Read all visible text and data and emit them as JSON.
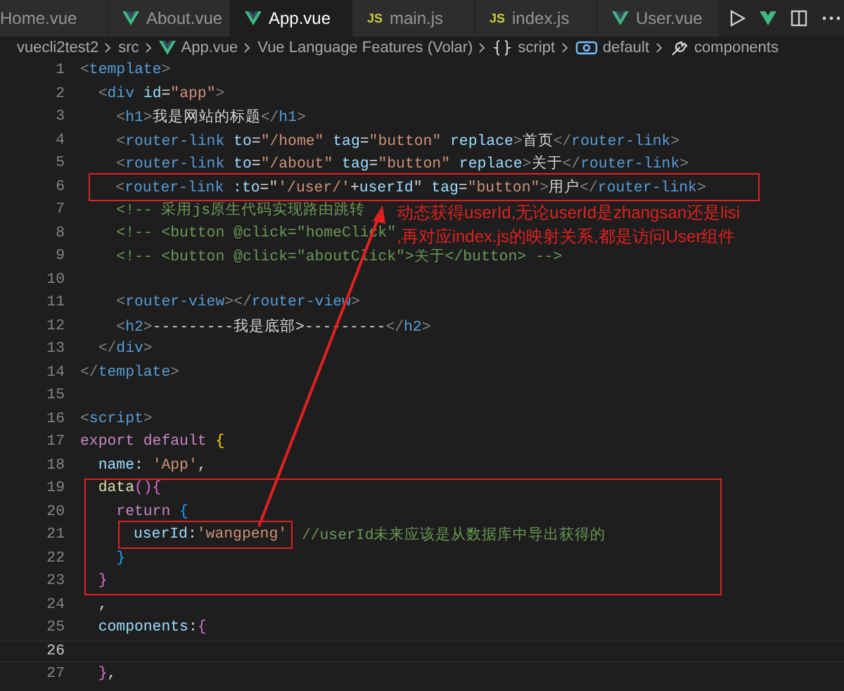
{
  "tabs": [
    {
      "label": "Home.vue",
      "kind": "plain",
      "selected": false
    },
    {
      "label": "About.vue",
      "kind": "vue",
      "selected": false
    },
    {
      "label": "App.vue",
      "kind": "vue",
      "selected": true
    },
    {
      "label": "main.js",
      "kind": "script",
      "badge": "JS",
      "selected": false
    },
    {
      "label": "index.js",
      "kind": "script",
      "badge": "JS",
      "selected": false
    },
    {
      "label": "User.vue",
      "kind": "vue",
      "selected": false
    }
  ],
  "breadcrumb": [
    {
      "label": "vuecli2test2",
      "kind": "plain"
    },
    {
      "label": "src",
      "kind": "plain"
    },
    {
      "label": "App.vue",
      "kind": "vue"
    },
    {
      "label": "Vue Language Features (Volar)",
      "kind": "plain"
    },
    {
      "label": "script",
      "kind": "braces"
    },
    {
      "label": "default",
      "kind": "module"
    },
    {
      "label": "components",
      "kind": "wrench"
    }
  ],
  "editor": {
    "lines": [
      {
        "number": "1",
        "current": false,
        "tokens": [
          {
            "text": "<",
            "kind": "punct"
          },
          {
            "text": "template",
            "kind": "tag"
          },
          {
            "text": ">",
            "kind": "punct"
          }
        ]
      },
      {
        "number": "2",
        "current": false,
        "tokens": [
          {
            "text": "  <",
            "kind": "punct"
          },
          {
            "text": "div",
            "kind": "tag"
          },
          {
            "text": " id",
            "kind": "attr"
          },
          {
            "text": "=",
            "kind": "plain"
          },
          {
            "text": "\"app\"",
            "kind": "string"
          },
          {
            "text": ">",
            "kind": "punct"
          }
        ]
      },
      {
        "number": "3",
        "current": false,
        "tokens": [
          {
            "text": "    <",
            "kind": "punct"
          },
          {
            "text": "h1",
            "kind": "tag"
          },
          {
            "text": ">",
            "kind": "punct"
          },
          {
            "text": "我是网站的标题",
            "kind": "plain"
          },
          {
            "text": "</",
            "kind": "punct"
          },
          {
            "text": "h1",
            "kind": "tag"
          },
          {
            "text": ">",
            "kind": "punct"
          }
        ]
      },
      {
        "number": "4",
        "current": false,
        "tokens": [
          {
            "text": "    <",
            "kind": "punct"
          },
          {
            "text": "router-link",
            "kind": "tag"
          },
          {
            "text": " to",
            "kind": "attr"
          },
          {
            "text": "=",
            "kind": "plain"
          },
          {
            "text": "\"/home\"",
            "kind": "string"
          },
          {
            "text": " tag",
            "kind": "attr"
          },
          {
            "text": "=",
            "kind": "plain"
          },
          {
            "text": "\"button\"",
            "kind": "string"
          },
          {
            "text": " replace",
            "kind": "attr"
          },
          {
            "text": ">",
            "kind": "punct"
          },
          {
            "text": "首页",
            "kind": "plain"
          },
          {
            "text": "</",
            "kind": "punct"
          },
          {
            "text": "router-link",
            "kind": "tag"
          },
          {
            "text": ">",
            "kind": "punct"
          }
        ]
      },
      {
        "number": "5",
        "current": false,
        "tokens": [
          {
            "text": "    <",
            "kind": "punct"
          },
          {
            "text": "router-link",
            "kind": "tag"
          },
          {
            "text": " to",
            "kind": "attr"
          },
          {
            "text": "=",
            "kind": "plain"
          },
          {
            "text": "\"/about\"",
            "kind": "string"
          },
          {
            "text": " tag",
            "kind": "attr"
          },
          {
            "text": "=",
            "kind": "plain"
          },
          {
            "text": "\"button\"",
            "kind": "string"
          },
          {
            "text": " replace",
            "kind": "attr"
          },
          {
            "text": ">",
            "kind": "punct"
          },
          {
            "text": "关于",
            "kind": "plain"
          },
          {
            "text": "</",
            "kind": "punct"
          },
          {
            "text": "router-link",
            "kind": "tag"
          },
          {
            "text": ">",
            "kind": "punct"
          }
        ]
      },
      {
        "number": "6",
        "current": false,
        "tokens": [
          {
            "text": "    <",
            "kind": "punct"
          },
          {
            "text": "router-link",
            "kind": "tag"
          },
          {
            "text": " :to",
            "kind": "attr"
          },
          {
            "text": "=\"",
            "kind": "plain"
          },
          {
            "text": "'/user/'",
            "kind": "string"
          },
          {
            "text": "+",
            "kind": "plain"
          },
          {
            "text": "userId",
            "kind": "attr"
          },
          {
            "text": "\"",
            "kind": "plain"
          },
          {
            "text": " tag",
            "kind": "attr"
          },
          {
            "text": "=",
            "kind": "plain"
          },
          {
            "text": "\"button\"",
            "kind": "string"
          },
          {
            "text": ">",
            "kind": "punct"
          },
          {
            "text": "用户",
            "kind": "plain"
          },
          {
            "text": "</",
            "kind": "punct"
          },
          {
            "text": "router-link",
            "kind": "tag"
          },
          {
            "text": ">",
            "kind": "punct"
          }
        ]
      },
      {
        "number": "7",
        "current": false,
        "tokens": [
          {
            "text": "    <!-- 采用js原生代码实现路由跳转",
            "kind": "comment"
          }
        ]
      },
      {
        "number": "8",
        "current": false,
        "tokens": [
          {
            "text": "    <!-- <button @click=\"homeClick\"",
            "kind": "comment"
          }
        ]
      },
      {
        "number": "9",
        "current": false,
        "tokens": [
          {
            "text": "    <!-- <button @click=\"aboutClick\">关于</button> -->",
            "kind": "comment"
          }
        ]
      },
      {
        "number": "10",
        "current": false
      },
      {
        "number": "11",
        "current": false,
        "tokens": [
          {
            "text": "    <",
            "kind": "punct"
          },
          {
            "text": "router-view",
            "kind": "tag"
          },
          {
            "text": "></",
            "kind": "punct"
          },
          {
            "text": "router-view",
            "kind": "tag"
          },
          {
            "text": ">",
            "kind": "punct"
          }
        ]
      },
      {
        "number": "12",
        "current": false,
        "tokens": [
          {
            "text": "    <",
            "kind": "punct"
          },
          {
            "text": "h2",
            "kind": "tag"
          },
          {
            "text": ">",
            "kind": "punct"
          },
          {
            "text": "---------我是底部>---------",
            "kind": "plain"
          },
          {
            "text": "</",
            "kind": "punct"
          },
          {
            "text": "h2",
            "kind": "tag"
          },
          {
            "text": ">",
            "kind": "punct"
          }
        ]
      },
      {
        "number": "13",
        "current": false,
        "tokens": [
          {
            "text": "  </",
            "kind": "punct"
          },
          {
            "text": "div",
            "kind": "tag"
          },
          {
            "text": ">",
            "kind": "punct"
          }
        ]
      },
      {
        "number": "14",
        "current": false,
        "tokens": [
          {
            "text": "</",
            "kind": "punct"
          },
          {
            "text": "template",
            "kind": "tag"
          },
          {
            "text": ">",
            "kind": "punct"
          }
        ]
      },
      {
        "number": "15",
        "current": false
      },
      {
        "number": "16",
        "current": false,
        "tokens": [
          {
            "text": "<",
            "kind": "punct"
          },
          {
            "text": "script",
            "kind": "tag"
          },
          {
            "text": ">",
            "kind": "punct"
          }
        ]
      },
      {
        "number": "17",
        "current": false,
        "tokens": [
          {
            "text": "export default",
            "kind": "keyword"
          },
          {
            "text": " {",
            "kind": "bracket1"
          }
        ]
      },
      {
        "number": "18",
        "current": false,
        "tokens": [
          {
            "text": "  name",
            "kind": "attr"
          },
          {
            "text": ": ",
            "kind": "plain"
          },
          {
            "text": "'App'",
            "kind": "string"
          },
          {
            "text": ",",
            "kind": "plain"
          }
        ]
      },
      {
        "number": "19",
        "current": false,
        "tokens": [
          {
            "text": "  data",
            "kind": "function"
          },
          {
            "text": "(){",
            "kind": "bracket2"
          }
        ]
      },
      {
        "number": "20",
        "current": false,
        "tokens": [
          {
            "text": "    return",
            "kind": "keyword"
          },
          {
            "text": " {",
            "kind": "bracket3"
          }
        ]
      },
      {
        "number": "21",
        "current": false,
        "tokens": [
          {
            "text": "      userId",
            "kind": "attr"
          },
          {
            "text": ":",
            "kind": "plain"
          },
          {
            "text": "'wangpeng'",
            "kind": "string"
          }
        ],
        "comment": "//userId未来应该是从数据库中导出获得的"
      },
      {
        "number": "22",
        "current": false,
        "tokens": [
          {
            "text": "    }",
            "kind": "bracket3"
          }
        ]
      },
      {
        "number": "23",
        "current": false,
        "tokens": [
          {
            "text": "  }",
            "kind": "bracket2"
          }
        ]
      },
      {
        "number": "24",
        "current": false,
        "tokens": [
          {
            "text": "  ,",
            "kind": "plain"
          }
        ]
      },
      {
        "number": "25",
        "current": false,
        "tokens": [
          {
            "text": "  components",
            "kind": "attr"
          },
          {
            "text": ":",
            "kind": "plain"
          },
          {
            "text": "{",
            "kind": "bracket2"
          }
        ]
      },
      {
        "number": "26",
        "current": true
      },
      {
        "number": "27",
        "current": false,
        "tokens": [
          {
            "text": "  }",
            "kind": "bracket2"
          },
          {
            "text": ",",
            "kind": "plain"
          }
        ]
      }
    ]
  },
  "annotation": {
    "lines": [
      "动态获得userId,无论userId是zhangsan还是lisi",
      ",再对应index.js的映射关系,都是访问User组件"
    ]
  }
}
